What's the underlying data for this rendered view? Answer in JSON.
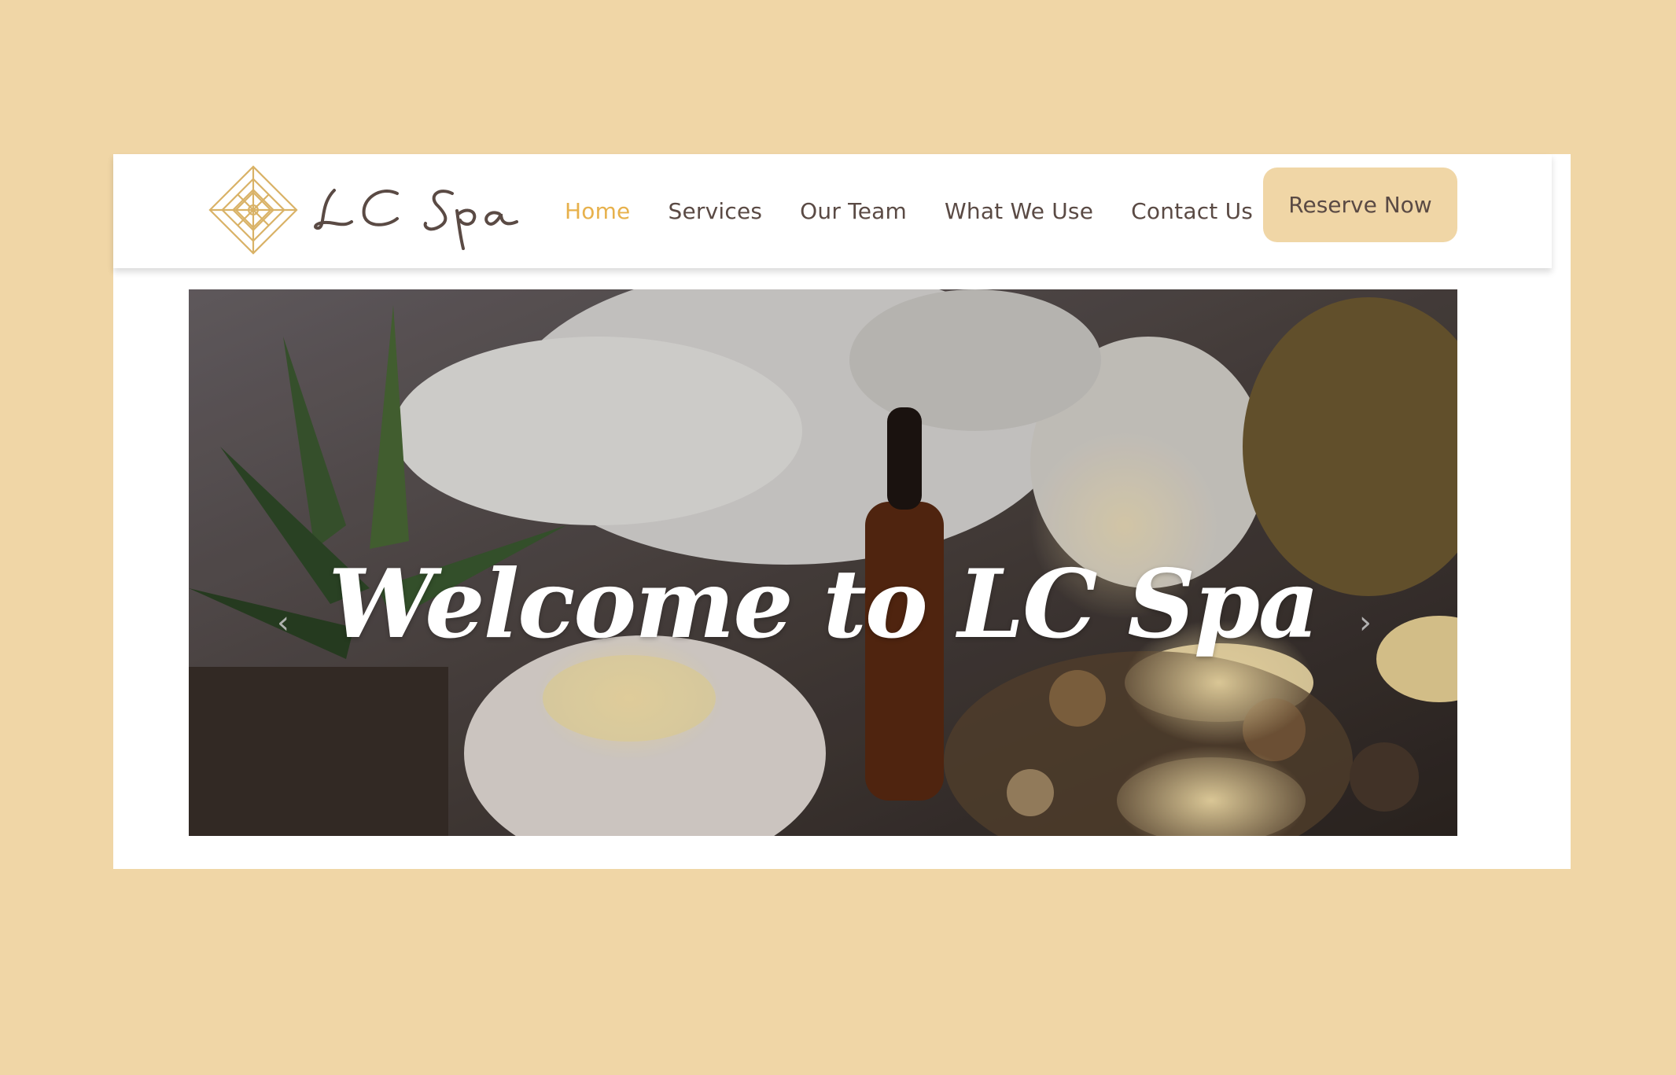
{
  "brand": {
    "name": "LC Spa",
    "logo_icon": "geometric-diamond-knot-icon",
    "accent": "#e7b14c"
  },
  "nav": {
    "items": [
      {
        "label": "Home",
        "active": true
      },
      {
        "label": "Services",
        "active": false
      },
      {
        "label": "Our Team",
        "active": false
      },
      {
        "label": "What We Use",
        "active": false
      },
      {
        "label": "Contact Us",
        "active": false
      }
    ],
    "cta_label": "Reserve Now"
  },
  "hero": {
    "title": "Welcome to LC Spa",
    "prev_icon": "chevron-left-icon",
    "next_icon": "chevron-right-icon"
  },
  "colors": {
    "page_background": "#f0d6a6",
    "text": "#5a4a44",
    "button_background": "#f0d6a6"
  }
}
